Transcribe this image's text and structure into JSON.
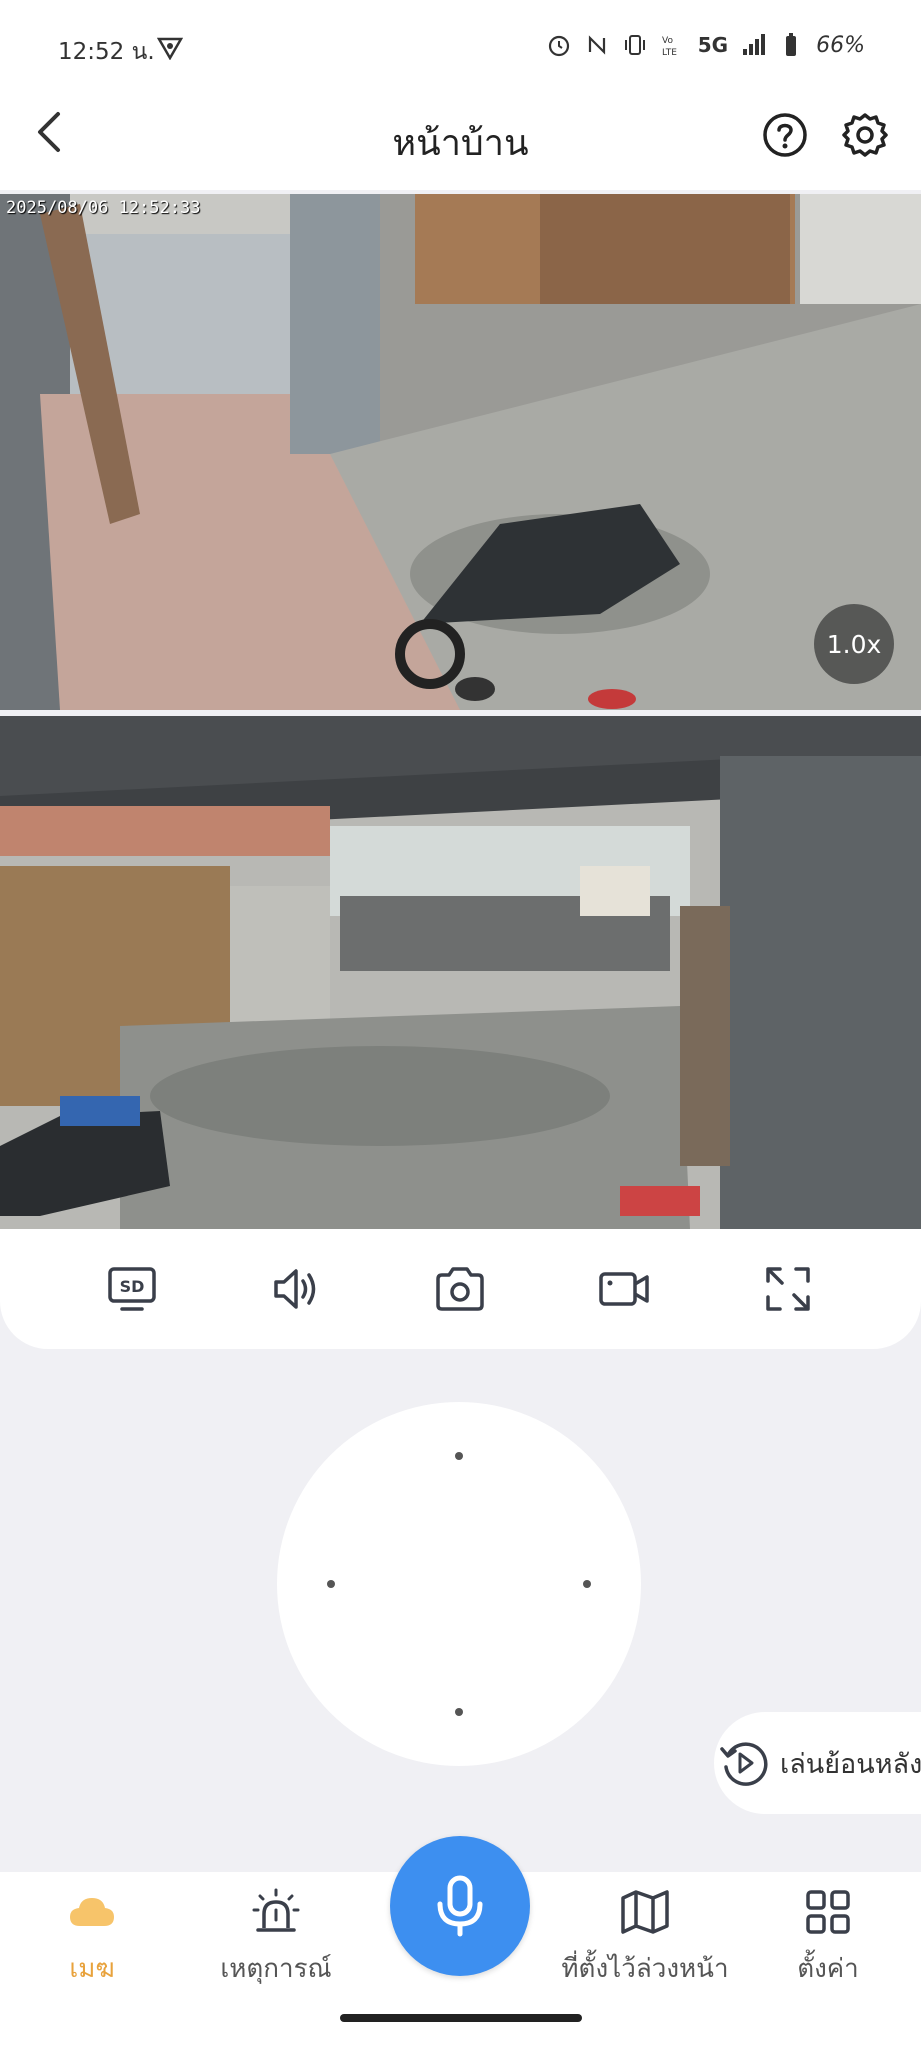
{
  "status_bar": {
    "time": "12:52 น.",
    "network": "5G",
    "battery": "66%"
  },
  "header": {
    "title": "หน้าบ้าน"
  },
  "video": {
    "timestamp": "2025/08/06 12:52:33",
    "zoom": "1.0x"
  },
  "toolbar": {
    "sd_label": "SD"
  },
  "playback": {
    "label": "เล่นย้อนหลัง"
  },
  "nav": {
    "items": [
      {
        "label": "เมฆ",
        "icon": "cloud-icon",
        "active": true
      },
      {
        "label": "เหตุการณ์",
        "icon": "alarm-icon",
        "active": false
      },
      {
        "label": "ที่ตั้งไว้ล่วงหน้า",
        "icon": "map-icon",
        "active": false
      },
      {
        "label": "ตั้งค่า",
        "icon": "grid-icon",
        "active": false
      }
    ]
  },
  "colors": {
    "accent": "#3d8ff0",
    "active_tab": "#e8a23c",
    "background": "#f0f0f4"
  }
}
